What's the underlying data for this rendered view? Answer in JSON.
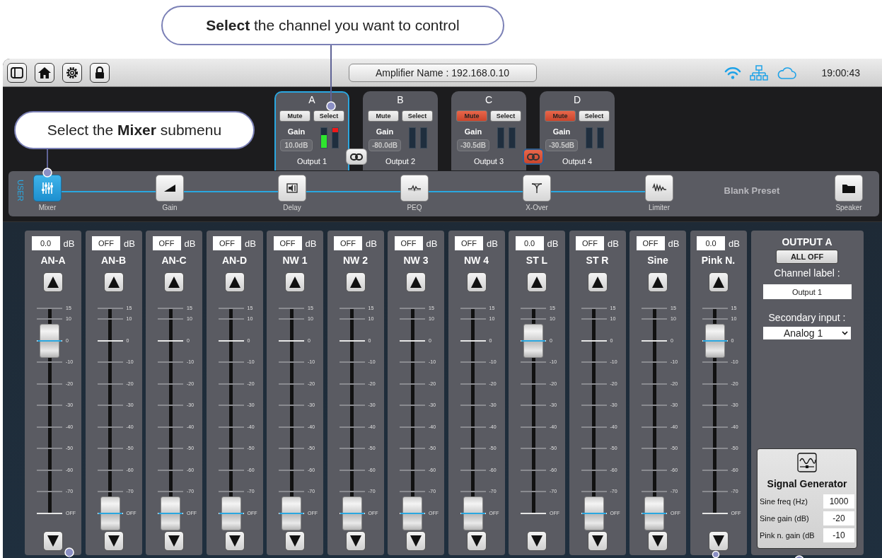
{
  "annotations": [
    {
      "text": "**Select** the channel you want to control"
    },
    {
      "text": "Select the **Mixer** submenu"
    }
  ],
  "toolbar": {
    "device_name": "Amplifier Name : 192.168.0.10",
    "time": "19:00:43"
  },
  "cards": [
    {
      "letter": "A",
      "selected": true,
      "mute": "Mute",
      "muted": false,
      "select": "Select",
      "gain_label": "Gain",
      "gain": "10.0dB",
      "meters": [
        {
          "level": 0.65,
          "clip": false
        },
        {
          "level": 0,
          "clip": true
        }
      ],
      "name": "Output 1"
    },
    {
      "letter": "B",
      "selected": false,
      "mute": "Mute",
      "muted": false,
      "select": "Select",
      "gain_label": "Gain",
      "gain": "-80.0dB",
      "meters": [
        {
          "level": 0,
          "clip": false
        },
        {
          "level": 0,
          "clip": false
        }
      ],
      "name": "Output 2"
    },
    {
      "letter": "C",
      "selected": false,
      "mute": "Mute",
      "muted": true,
      "select": "Select",
      "gain_label": "Gain",
      "gain": "-30.5dB",
      "meters": [
        {
          "level": 0,
          "clip": false
        },
        {
          "level": 0,
          "clip": false
        }
      ],
      "name": "Output 3"
    },
    {
      "letter": "D",
      "selected": false,
      "mute": "Mute",
      "muted": true,
      "select": "Select",
      "gain_label": "Gain",
      "gain": "-30.5dB",
      "meters": [
        {
          "level": 0,
          "clip": false
        },
        {
          "level": 0,
          "clip": false
        }
      ],
      "name": "Output 4"
    }
  ],
  "links": [
    {
      "on": false
    },
    {
      "on": true
    }
  ],
  "pipeline": {
    "side_label": "USER",
    "stages": [
      {
        "label": "Mixer",
        "selected": true
      },
      {
        "label": "Gain",
        "selected": false
      },
      {
        "label": "Delay",
        "selected": false
      },
      {
        "label": "PEQ",
        "selected": false
      },
      {
        "label": "X-Over",
        "selected": false
      },
      {
        "label": "Limiter",
        "selected": false
      }
    ],
    "preset": "Blank Preset",
    "speaker": "Speaker"
  },
  "strips": [
    {
      "value": "0.0",
      "unit": "dB",
      "name": "AN-A",
      "level": 0.84,
      "scale": [
        "15",
        "10",
        "0",
        "-10",
        "-20",
        "-30",
        "-40",
        "-50",
        "-60",
        "-70",
        "OFF"
      ]
    },
    {
      "value": "OFF",
      "unit": "dB",
      "name": "AN-B",
      "level": 0,
      "scale": [
        "15",
        "10",
        "0",
        "-10",
        "-20",
        "-30",
        "-40",
        "-50",
        "-60",
        "-70",
        "OFF"
      ]
    },
    {
      "value": "OFF",
      "unit": "dB",
      "name": "AN-C",
      "level": 0,
      "scale": [
        "15",
        "10",
        "0",
        "-10",
        "-20",
        "-30",
        "-40",
        "-50",
        "-60",
        "-70",
        "OFF"
      ]
    },
    {
      "value": "OFF",
      "unit": "dB",
      "name": "AN-D",
      "level": 0,
      "scale": [
        "15",
        "10",
        "0",
        "-10",
        "-20",
        "-30",
        "-40",
        "-50",
        "-60",
        "-70",
        "OFF"
      ]
    },
    {
      "value": "OFF",
      "unit": "dB",
      "name": "NW 1",
      "level": 0,
      "scale": [
        "15",
        "10",
        "0",
        "-10",
        "-20",
        "-30",
        "-40",
        "-50",
        "-60",
        "-70",
        "OFF"
      ]
    },
    {
      "value": "OFF",
      "unit": "dB",
      "name": "NW 2",
      "level": 0,
      "scale": [
        "15",
        "10",
        "0",
        "-10",
        "-20",
        "-30",
        "-40",
        "-50",
        "-60",
        "-70",
        "OFF"
      ]
    },
    {
      "value": "OFF",
      "unit": "dB",
      "name": "NW 3",
      "level": 0,
      "scale": [
        "15",
        "10",
        "0",
        "-10",
        "-20",
        "-30",
        "-40",
        "-50",
        "-60",
        "-70",
        "OFF"
      ]
    },
    {
      "value": "OFF",
      "unit": "dB",
      "name": "NW 4",
      "level": 0,
      "scale": [
        "15",
        "10",
        "0",
        "-10",
        "-20",
        "-30",
        "-40",
        "-50",
        "-60",
        "-70",
        "OFF"
      ]
    },
    {
      "value": "0.0",
      "unit": "dB",
      "name": "ST L",
      "level": 0.84,
      "scale": [
        "15",
        "10",
        "0",
        "-10",
        "-20",
        "-30",
        "-40",
        "-50",
        "-60",
        "-70",
        "OFF"
      ]
    },
    {
      "value": "OFF",
      "unit": "dB",
      "name": "ST R",
      "level": 0,
      "scale": [
        "15",
        "10",
        "0",
        "-10",
        "-20",
        "-30",
        "-40",
        "-50",
        "-60",
        "-70",
        "OFF"
      ]
    },
    {
      "value": "OFF",
      "unit": "dB",
      "name": "Sine",
      "level": 0,
      "scale": [
        "15",
        "10",
        "0",
        "-10",
        "-20",
        "-30",
        "-40",
        "-50",
        "-60",
        "-70",
        "OFF"
      ]
    },
    {
      "value": "0.0",
      "unit": "dB",
      "name": "Pink N.",
      "level": 0.84,
      "scale": [
        "15",
        "10",
        "0",
        "-10",
        "-20",
        "-30",
        "-40",
        "-50",
        "-60",
        "-70",
        "OFF"
      ]
    }
  ],
  "output": {
    "title": "OUTPUT A",
    "all_off": "ALL OFF",
    "label_caption": "Channel label :",
    "label_value": "Output 1",
    "input_caption": "Secondary input :",
    "input_value": "Analog 1",
    "generator": {
      "title": "Signal Generator",
      "rows": [
        {
          "label": "Sine freq (Hz)",
          "value": "1000"
        },
        {
          "label": "Sine gain (dB)",
          "value": "-20"
        },
        {
          "label": "Pink n. gain (dB",
          "value": "-10"
        }
      ]
    }
  }
}
